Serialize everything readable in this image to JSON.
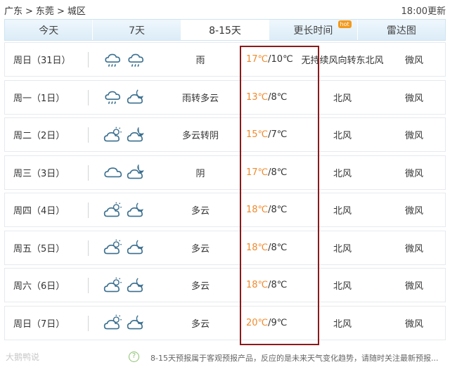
{
  "breadcrumb": [
    "广东",
    ">",
    "东莞",
    ">",
    "城区"
  ],
  "update_time": "18:00更新",
  "tabs": [
    {
      "label": "今天"
    },
    {
      "label": "7天"
    },
    {
      "label": "8-15天",
      "active": true
    },
    {
      "label": "更长时间",
      "badge": "hot"
    },
    {
      "label": "雷达图"
    }
  ],
  "forecast": [
    {
      "day": "周日（31日）",
      "icon1": "rain-cloud-icon",
      "icon2": "rain-cloud-icon",
      "weather": "雨",
      "high": "17℃",
      "low": "/10℃",
      "wind": "无持续风向转东北风",
      "level": "微风"
    },
    {
      "day": "周一（1日）",
      "icon1": "rain-cloud-icon",
      "icon2": "partly-cloudy-night-icon",
      "weather": "雨转多云",
      "high": "13℃",
      "low": "/8℃",
      "wind": "北风",
      "level": "微风"
    },
    {
      "day": "周二（2日）",
      "icon1": "partly-cloudy-icon",
      "icon2": "cloud-moon-icon",
      "weather": "多云转阴",
      "high": "15℃",
      "low": "/7℃",
      "wind": "北风",
      "level": "微风"
    },
    {
      "day": "周三（3日）",
      "icon1": "cloud-icon",
      "icon2": "cloud-moon-icon",
      "weather": "阴",
      "high": "17℃",
      "low": "/8℃",
      "wind": "北风",
      "level": "微风"
    },
    {
      "day": "周四（4日）",
      "icon1": "partly-cloudy-icon",
      "icon2": "partly-cloudy-night-icon",
      "weather": "多云",
      "high": "18℃",
      "low": "/8℃",
      "wind": "北风",
      "level": "微风"
    },
    {
      "day": "周五（5日）",
      "icon1": "partly-cloudy-icon",
      "icon2": "partly-cloudy-night-icon",
      "weather": "多云",
      "high": "18℃",
      "low": "/8℃",
      "wind": "北风",
      "level": "微风"
    },
    {
      "day": "周六（6日）",
      "icon1": "partly-cloudy-icon",
      "icon2": "partly-cloudy-night-icon",
      "weather": "多云",
      "high": "18℃",
      "low": "/8℃",
      "wind": "北风",
      "level": "微风"
    },
    {
      "day": "周日（7日）",
      "icon1": "partly-cloudy-icon",
      "icon2": "partly-cloudy-night-icon",
      "weather": "多云",
      "high": "20℃",
      "low": "/9℃",
      "wind": "北风",
      "level": "微风"
    }
  ],
  "footer": {
    "watermark": "大鹅鸭说",
    "help_icon": "?",
    "note": "8-15天预报属于客观预报产品，反应的是未来天气变化趋势，请随时关注最新预报..."
  },
  "colors": {
    "high_temp": "#f08a2c",
    "highlight_box": "#8b1a1a",
    "icon_stroke": "#3a6f8f",
    "tab_bg": "#dcecf7"
  }
}
